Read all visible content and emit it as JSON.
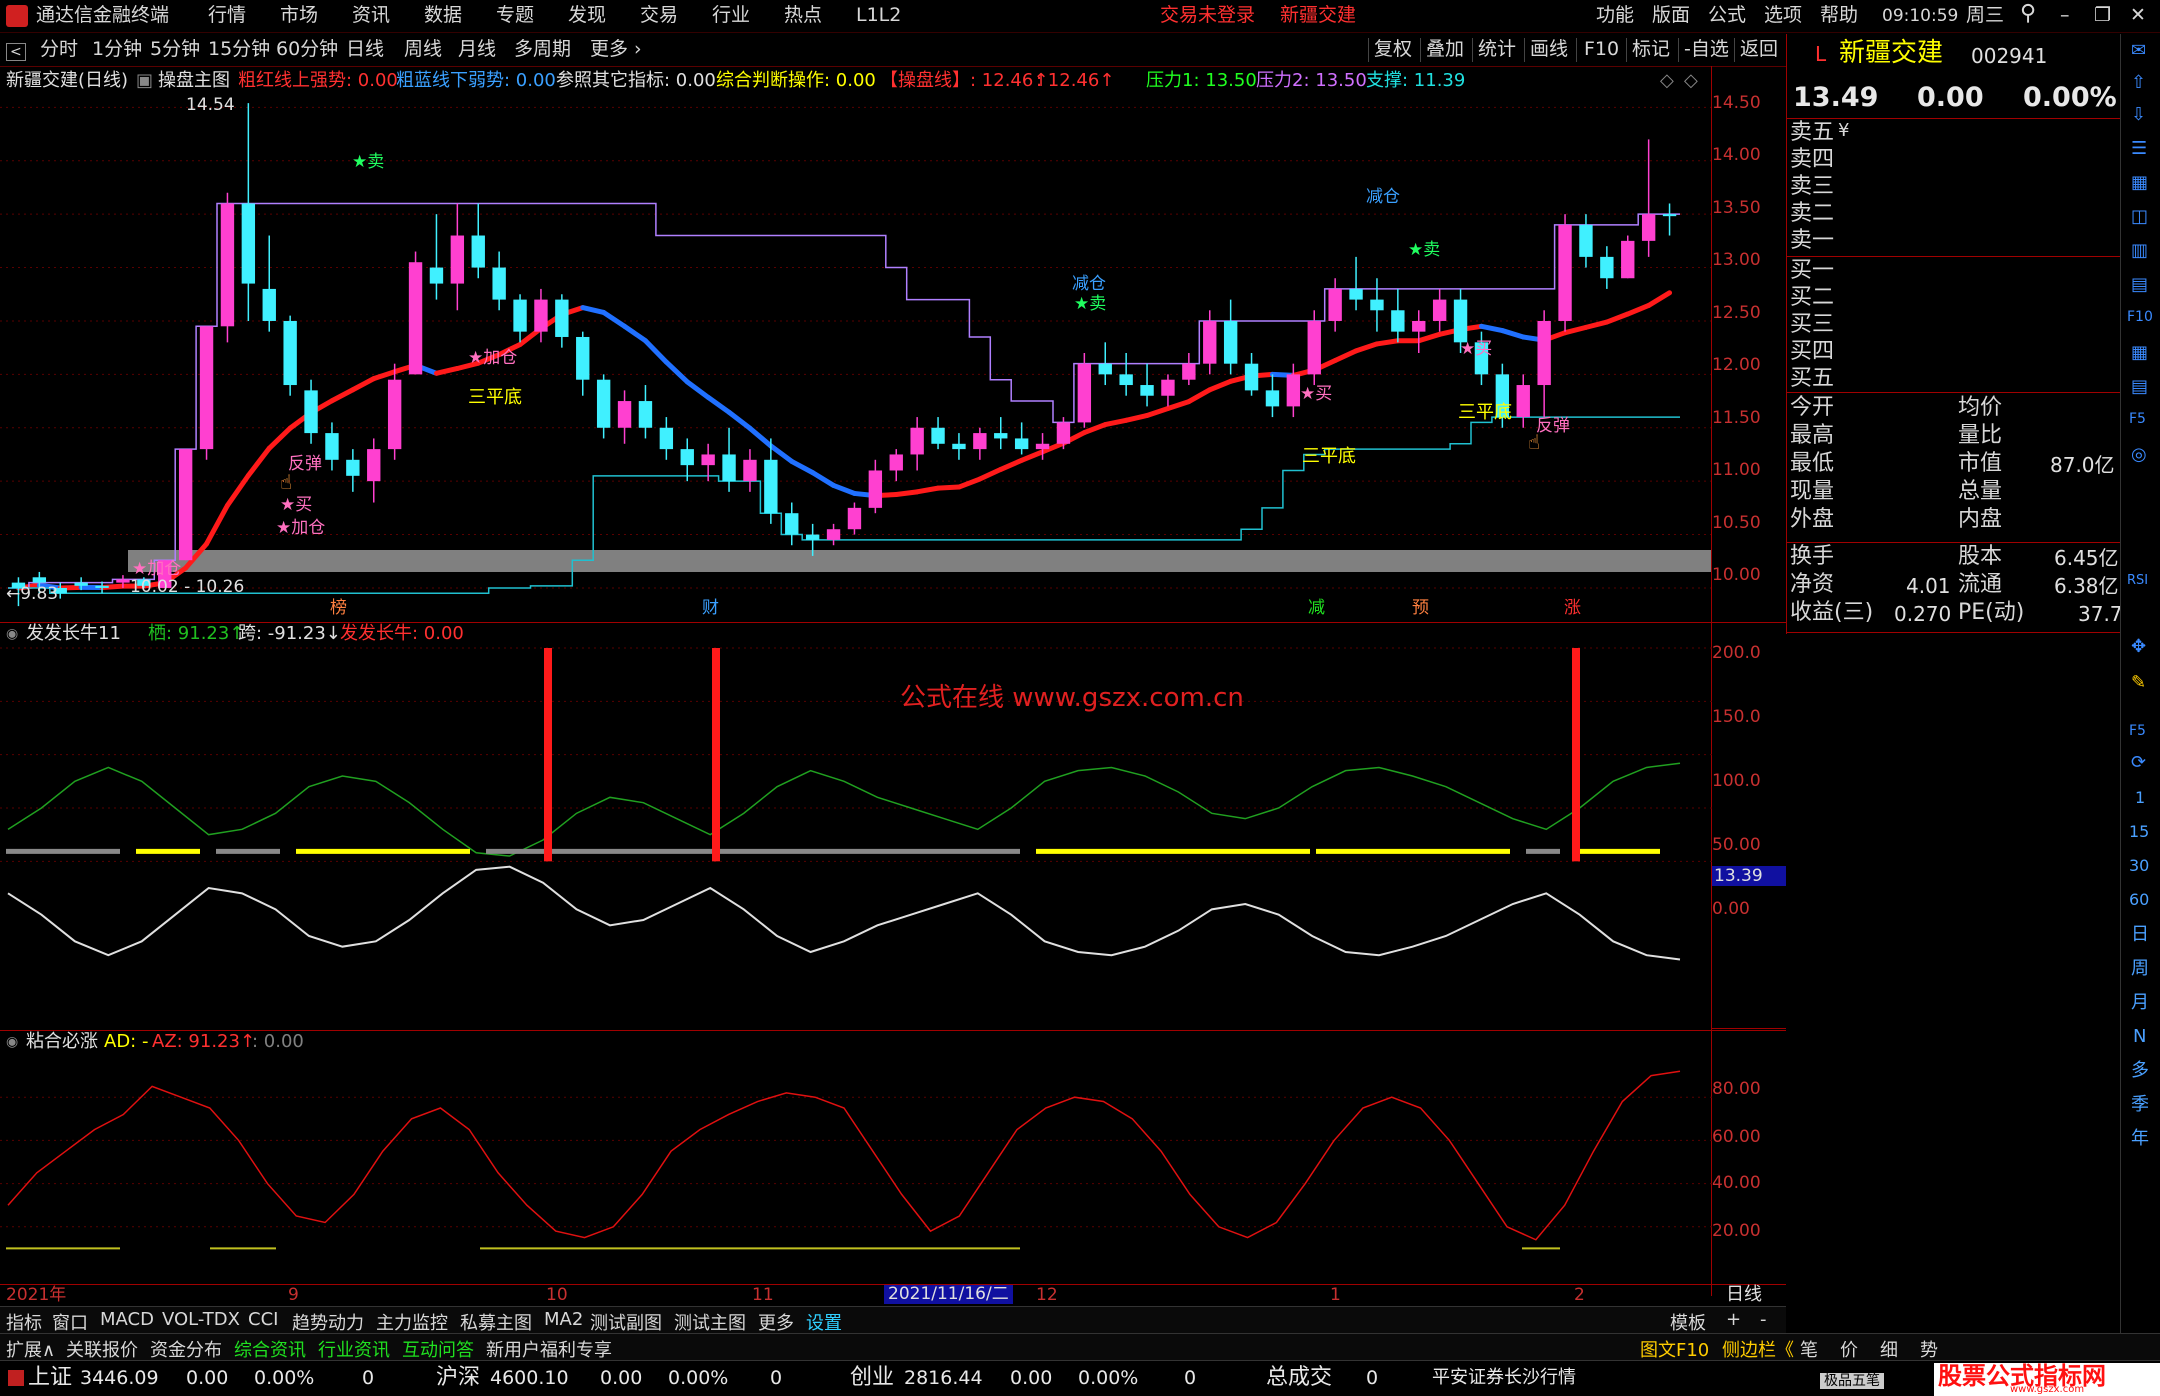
{
  "app": {
    "name": "通达信金融终端",
    "menu": [
      "行情",
      "市场",
      "资讯",
      "数据",
      "专题",
      "发现",
      "交易",
      "行业",
      "热点",
      "L1L2"
    ],
    "login_status": "交易未登录",
    "stock_tab": "新疆交建",
    "right_menu": [
      "功能",
      "版面",
      "公式",
      "选项",
      "帮助"
    ],
    "time": "09:10:59",
    "weekday": "周三"
  },
  "period_bar": {
    "items": [
      "分时",
      "1分钟",
      "5分钟",
      "15分钟",
      "60分钟",
      "日线",
      "周线",
      "月线",
      "多周期",
      "更多"
    ],
    "active": "日线",
    "tools": [
      "复权",
      "叠加",
      "统计",
      "画线",
      "F10",
      "标记",
      "-自选",
      "返回"
    ]
  },
  "chart_header": {
    "stock": "新疆交建(日线)",
    "indicator": "操盘主图",
    "items": [
      {
        "text": "粗红线上强势: 0.00",
        "color": "#ff3030"
      },
      {
        "text": "粗蓝线下弱势: 0.00",
        "color": "#3aa0ff"
      },
      {
        "text": "参照其它指标: 0.00",
        "color": "#e0e0e0"
      },
      {
        "text": "综合判断操作: 0.00",
        "color": "#ffff00"
      },
      {
        "text": "【操盘线】: 12.46↑",
        "color": "#ff3030"
      },
      {
        "text": ": 12.46↑",
        "color": "#ff3030"
      },
      {
        "text": "压力1: 13.50",
        "color": "#20ff20"
      },
      {
        "text": "压力2: 13.50",
        "color": "#d070ff"
      },
      {
        "text": "支撑: 11.39",
        "color": "#20e0e0"
      }
    ]
  },
  "quote": {
    "name": "新疆交建",
    "code": "002941",
    "price": "13.49",
    "change": "0.00",
    "change_pct": "0.00%",
    "sell_labels": [
      "卖五",
      "卖四",
      "卖三",
      "卖二",
      "卖一"
    ],
    "sell_unit": "¥",
    "buy_labels": [
      "买一",
      "买二",
      "买三",
      "买四",
      "买五"
    ],
    "stats_left": [
      "今开",
      "最高",
      "最低",
      "现量",
      "外盘"
    ],
    "stats_right_labels": [
      "均价",
      "量比",
      "市值",
      "总量",
      "内盘"
    ],
    "stats_right_values": [
      "",
      "",
      "87.0亿",
      "",
      ""
    ],
    "fin": [
      {
        "l": "换手",
        "v": "",
        "l2": "股本",
        "v2": "6.45亿"
      },
      {
        "l": "净资",
        "v": "4.01",
        "l2": "流通",
        "v2": "6.38亿"
      },
      {
        "l": "收益(三)",
        "v": "0.270",
        "l2": "PE(动)",
        "v2": "37.7"
      }
    ]
  },
  "side_toolbar": [
    "1",
    "15",
    "30",
    "60",
    "日",
    "周",
    "月",
    "N",
    "多",
    "季",
    "年"
  ],
  "main_chart": {
    "y_ticks": [
      "14.50",
      "14.00",
      "13.50",
      "13.00",
      "12.50",
      "12.00",
      "11.50",
      "11.00",
      "10.50",
      "10.00"
    ],
    "high_label": "14.54",
    "low_label": "←9.83",
    "band_label": "10.02 - 10.26",
    "bottom_marks": [
      {
        "text": "榜",
        "color": "#ff8040"
      },
      {
        "text": "财",
        "color": "#3aa0ff"
      },
      {
        "text": "减",
        "color": "#20e020"
      },
      {
        "text": "预",
        "color": "#ff8040"
      },
      {
        "text": "涨",
        "color": "#ff3030"
      }
    ],
    "annotations": [
      {
        "text": "★卖",
        "color": "#20ff60"
      },
      {
        "text": "★加仓",
        "color": "#ff70c0"
      },
      {
        "text": "三平底",
        "color": "#ffff00"
      },
      {
        "text": "反弹",
        "color": "#ff70c0"
      },
      {
        "text": "★买",
        "color": "#ff70c0"
      },
      {
        "text": "★加仓",
        "color": "#ff70c0"
      },
      {
        "text": "★加仓",
        "color": "#ff70c0"
      },
      {
        "text": "减仓",
        "color": "#3aa0ff"
      },
      {
        "text": "★卖",
        "color": "#20ff60"
      },
      {
        "text": "三平底",
        "color": "#ffff00"
      },
      {
        "text": "减仓",
        "color": "#3aa0ff"
      },
      {
        "text": "★卖",
        "color": "#20ff60"
      },
      {
        "text": "★买",
        "color": "#ff70c0"
      },
      {
        "text": "★买",
        "color": "#ff70c0"
      },
      {
        "text": "三平底",
        "color": "#ffff00"
      },
      {
        "text": "反弹",
        "color": "#ff70c0"
      }
    ]
  },
  "sub1": {
    "title": "发发长牛11",
    "items": [
      {
        "text": "栖: 91.23↑",
        "color": "#20c020"
      },
      {
        "text": "跨: -91.23↓",
        "color": "#e0e0e0"
      },
      {
        "text": "发发长牛: 0.00",
        "color": "#ff3030"
      }
    ],
    "y_ticks": [
      "200.0",
      "150.0",
      "100.0",
      "50.00",
      "0.00"
    ],
    "watermark": "公式在线  www.gszx.com.cn",
    "price_tag": "13.39"
  },
  "sub2": {
    "title": "粘合必涨",
    "items": [
      {
        "text": "AD: -",
        "color": "#ffff00"
      },
      {
        "text": "AZ: 91.23↑",
        "color": "#ff3030"
      },
      {
        "text": ": 0.00",
        "color": "#808080"
      }
    ],
    "y_ticks": [
      "80.00",
      "60.00",
      "40.00",
      "20.00"
    ]
  },
  "x_axis": {
    "labels": [
      "2021年",
      "9",
      "10",
      "11",
      "2021/11/16/二",
      "12",
      "1",
      "2"
    ],
    "period": "日线"
  },
  "tabs_row1": [
    "指标",
    "窗口",
    "MACD",
    "VOL-TDX",
    "CCI",
    "趋势动力",
    "主力监控",
    "私募主图",
    "MA2",
    "测试副图",
    "测试主图",
    "更多",
    "设置"
  ],
  "tabs_row1_right": [
    "模板",
    "+",
    "-"
  ],
  "tabs_row2": [
    "扩展∧",
    "关联报价",
    "资金分布",
    "综合资讯",
    "行业资讯",
    "互动问答",
    "新用户福利专享"
  ],
  "tabs_row2_right": [
    "图文F10",
    "侧边栏《",
    "笔",
    "价",
    "细",
    "势"
  ],
  "status": {
    "indices": [
      {
        "name": "上证",
        "value": "3446.09",
        "chg": "0.00",
        "pct": "0.00%",
        "vol": "0"
      },
      {
        "name": "沪深",
        "value": "4600.10",
        "chg": "0.00",
        "pct": "0.00%",
        "vol": "0"
      },
      {
        "name": "创业",
        "value": "2816.44",
        "chg": "0.00",
        "pct": "0.00%",
        "vol": "0"
      }
    ],
    "total_label": "总成交",
    "total_value": "0",
    "broker": "平安证券长沙行情",
    "level2": "极品五笔",
    "brand": "股票公式指标网",
    "brand_url": "www.gszx.com"
  },
  "chart_data": [
    {
      "type": "candlestick",
      "title": "新疆交建(日线)",
      "ylim": [
        9.7,
        14.7
      ],
      "series": [
        {
          "name": "K线",
          "values": [
            [
              10.05,
              10.1,
              9.83,
              10.0
            ],
            [
              10.1,
              10.15,
              9.95,
              10.05
            ],
            [
              10.0,
              10.05,
              9.9,
              9.95
            ],
            [
              10.05,
              10.1,
              9.98,
              10.02
            ],
            [
              10.02,
              10.06,
              9.95,
              10.0
            ],
            [
              10.05,
              10.12,
              10.0,
              10.08
            ],
            [
              10.08,
              10.1,
              10.0,
              10.02
            ],
            [
              10.0,
              10.26,
              10.0,
              10.26
            ],
            [
              10.26,
              11.3,
              10.26,
              11.3
            ],
            [
              11.3,
              12.45,
              11.2,
              12.45
            ],
            [
              12.45,
              13.7,
              12.3,
              13.6
            ],
            [
              13.6,
              14.54,
              12.5,
              12.85
            ],
            [
              12.8,
              13.3,
              12.4,
              12.5
            ],
            [
              12.5,
              12.55,
              11.8,
              11.9
            ],
            [
              11.85,
              11.95,
              11.35,
              11.45
            ],
            [
              11.45,
              11.55,
              11.1,
              11.2
            ],
            [
              11.2,
              11.3,
              10.9,
              11.05
            ],
            [
              11.0,
              11.4,
              10.8,
              11.3
            ],
            [
              11.3,
              12.1,
              11.2,
              11.95
            ],
            [
              12.0,
              13.15,
              12.0,
              13.05
            ],
            [
              13.0,
              13.5,
              12.7,
              12.85
            ],
            [
              12.85,
              13.6,
              12.6,
              13.3
            ],
            [
              13.3,
              13.6,
              12.9,
              13.0
            ],
            [
              13.0,
              13.15,
              12.6,
              12.7
            ],
            [
              12.7,
              12.75,
              12.3,
              12.4
            ],
            [
              12.4,
              12.8,
              12.3,
              12.7
            ],
            [
              12.7,
              12.75,
              12.25,
              12.35
            ],
            [
              12.35,
              12.4,
              11.8,
              11.95
            ],
            [
              11.95,
              12.0,
              11.4,
              11.5
            ],
            [
              11.5,
              11.85,
              11.35,
              11.75
            ],
            [
              11.75,
              11.9,
              11.4,
              11.5
            ],
            [
              11.5,
              11.6,
              11.2,
              11.3
            ],
            [
              11.3,
              11.4,
              11.0,
              11.15
            ],
            [
              11.15,
              11.35,
              11.0,
              11.25
            ],
            [
              11.25,
              11.5,
              10.9,
              11.0
            ],
            [
              11.0,
              11.3,
              10.9,
              11.2
            ],
            [
              11.2,
              11.4,
              10.6,
              10.7
            ],
            [
              10.7,
              10.8,
              10.4,
              10.5
            ],
            [
              10.5,
              10.6,
              10.3,
              10.45
            ],
            [
              10.45,
              10.6,
              10.4,
              10.55
            ],
            [
              10.55,
              10.8,
              10.5,
              10.75
            ],
            [
              10.75,
              11.2,
              10.7,
              11.1
            ],
            [
              11.1,
              11.3,
              11.0,
              11.25
            ],
            [
              11.25,
              11.6,
              11.1,
              11.5
            ],
            [
              11.5,
              11.6,
              11.3,
              11.35
            ],
            [
              11.35,
              11.45,
              11.2,
              11.3
            ],
            [
              11.3,
              11.5,
              11.2,
              11.45
            ],
            [
              11.45,
              11.6,
              11.3,
              11.4
            ],
            [
              11.4,
              11.55,
              11.25,
              11.3
            ],
            [
              11.3,
              11.45,
              11.2,
              11.35
            ],
            [
              11.35,
              11.6,
              11.3,
              11.55
            ],
            [
              11.55,
              12.2,
              11.5,
              12.1
            ],
            [
              12.1,
              12.3,
              11.9,
              12.0
            ],
            [
              12.0,
              12.2,
              11.8,
              11.9
            ],
            [
              11.9,
              12.1,
              11.7,
              11.8
            ],
            [
              11.8,
              12.0,
              11.7,
              11.95
            ],
            [
              11.95,
              12.2,
              11.9,
              12.1
            ],
            [
              12.1,
              12.6,
              12.0,
              12.5
            ],
            [
              12.5,
              12.7,
              12.0,
              12.1
            ],
            [
              12.1,
              12.2,
              11.8,
              11.85
            ],
            [
              11.85,
              12.0,
              11.6,
              11.7
            ],
            [
              11.7,
              12.1,
              11.6,
              12.0
            ],
            [
              12.0,
              12.6,
              11.9,
              12.5
            ],
            [
              12.5,
              12.9,
              12.4,
              12.8
            ],
            [
              12.8,
              13.1,
              12.6,
              12.7
            ],
            [
              12.7,
              12.9,
              12.4,
              12.6
            ],
            [
              12.6,
              12.8,
              12.3,
              12.4
            ],
            [
              12.4,
              12.6,
              12.2,
              12.5
            ],
            [
              12.5,
              12.8,
              12.4,
              12.7
            ],
            [
              12.7,
              12.8,
              12.2,
              12.3
            ],
            [
              12.3,
              12.4,
              11.9,
              12.0
            ],
            [
              12.0,
              12.1,
              11.5,
              11.6
            ],
            [
              11.6,
              12.0,
              11.5,
              11.9
            ],
            [
              11.9,
              12.6,
              11.6,
              12.5
            ],
            [
              12.5,
              13.5,
              12.4,
              13.4
            ],
            [
              13.4,
              13.5,
              13.0,
              13.1
            ],
            [
              13.1,
              13.2,
              12.8,
              12.9
            ],
            [
              12.9,
              13.3,
              12.9,
              13.25
            ],
            [
              13.25,
              14.2,
              13.1,
              13.5
            ],
            [
              13.5,
              13.6,
              13.3,
              13.49
            ]
          ]
        }
      ]
    },
    {
      "type": "line",
      "title": "发发长牛11",
      "ylim": [
        -130,
        200
      ],
      "series": [
        {
          "name": "栖",
          "values": [
            30,
            50,
            75,
            88,
            75,
            50,
            25,
            30,
            45,
            70,
            80,
            75,
            55,
            30,
            8,
            5,
            20,
            45,
            60,
            55,
            40,
            25,
            45,
            70,
            85,
            75,
            60,
            50,
            40,
            30,
            50,
            75,
            85,
            88,
            80,
            65,
            45,
            40,
            50,
            70,
            85,
            88,
            80,
            70,
            55,
            40,
            30,
            50,
            75,
            88,
            92
          ]
        },
        {
          "name": "跨",
          "values": [
            -30,
            -50,
            -75,
            -88,
            -75,
            -50,
            -25,
            -30,
            -45,
            -70,
            -80,
            -75,
            -55,
            -30,
            -8,
            -5,
            -20,
            -45,
            -60,
            -55,
            -40,
            -25,
            -45,
            -70,
            -85,
            -75,
            -60,
            -50,
            -40,
            -30,
            -50,
            -75,
            -85,
            -88,
            -80,
            -65,
            -45,
            -40,
            -50,
            -70,
            -85,
            -88,
            -80,
            -70,
            -55,
            -40,
            -30,
            -50,
            -75,
            -88,
            -92
          ]
        },
        {
          "name": "发发长牛",
          "values": [
            200,
            200,
            200
          ]
        }
      ]
    },
    {
      "type": "line",
      "title": "粘合必涨",
      "ylim": [
        0,
        100
      ],
      "series": [
        {
          "name": "AZ",
          "values": [
            30,
            45,
            55,
            65,
            72,
            85,
            80,
            75,
            60,
            40,
            25,
            22,
            35,
            55,
            70,
            75,
            65,
            45,
            30,
            18,
            15,
            20,
            35,
            55,
            65,
            72,
            78,
            82,
            80,
            75,
            55,
            35,
            18,
            25,
            45,
            65,
            75,
            80,
            78,
            70,
            55,
            35,
            20,
            15,
            22,
            40,
            60,
            75,
            80,
            75,
            60,
            40,
            20,
            14,
            30,
            55,
            78,
            90,
            92
          ]
        }
      ]
    }
  ]
}
